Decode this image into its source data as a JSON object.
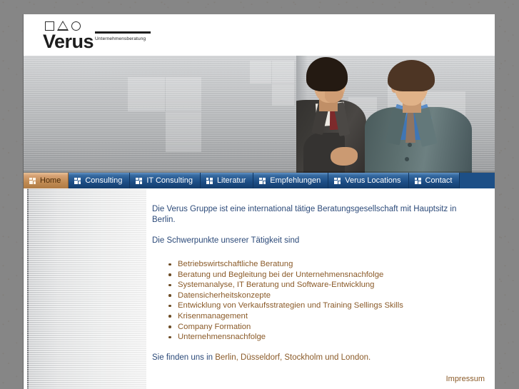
{
  "site": {
    "logo": {
      "wordmark": "Verus",
      "tagline": "Unternehmensberatung",
      "shapes": [
        "square",
        "triangle",
        "circle"
      ]
    }
  },
  "hero": {
    "alt": "Two businessmen in suits talking",
    "icons": {
      "photo": "businessmen-photo"
    }
  },
  "nav": {
    "active_index": 0,
    "icon_name": "four-squares-icon",
    "items": [
      {
        "label": "Home"
      },
      {
        "label": "Consulting"
      },
      {
        "label": "IT Consulting"
      },
      {
        "label": "Literatur"
      },
      {
        "label": "Empfehlungen"
      },
      {
        "label": "Verus Locations"
      },
      {
        "label": "Contact"
      }
    ]
  },
  "main": {
    "intro": "Die Verus Gruppe ist eine international tätige Beratungsgesellschaft mit Hauptsitz in Berlin.",
    "subhead": "Die Schwerpunkte unserer Tätigkeit sind",
    "services": [
      "Betriebswirtschaftliche Beratung",
      "Beratung und Begleitung bei der Unternehmensnachfolge",
      "Systemanalyse, IT Beratung und Software-Entwicklung",
      "Datensicherheitskonzepte",
      "Entwicklung von Verkaufsstrategien und Training Sellings Skills",
      "Krisenmanagement",
      "Company Formation",
      "Unternehmensnachfolge"
    ],
    "locations_prefix": "Sie finden uns in ",
    "locations_cities": "Berlin, Düsseldorf, Stockholm und London."
  },
  "footer": {
    "impressum": "Impressum"
  },
  "colors": {
    "page_background": "#868686",
    "nav_blue": "#1d4e86",
    "nav_active_orange": "#c08b53",
    "text_blue": "#2c4a79",
    "text_brown": "#8a5a28"
  }
}
